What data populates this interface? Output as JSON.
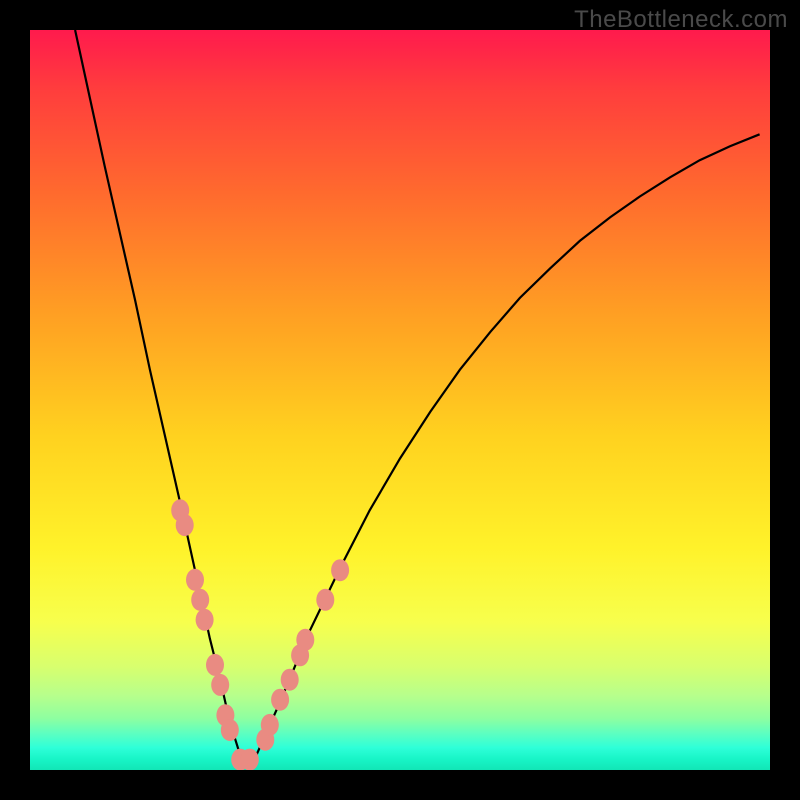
{
  "watermark": "TheBottleneck.com",
  "chart_data": {
    "type": "line",
    "title": "",
    "xlabel": "",
    "ylabel": "",
    "xlim": [
      0,
      100
    ],
    "ylim": [
      0,
      100
    ],
    "note": "V-shaped bottleneck curve; y is bottleneck percentage (0 at bottom = no bottleneck, 100 at top). Values estimated from pixel positions — no axes/ticks rendered in image.",
    "series": [
      {
        "name": "curve",
        "x": [
          6.1,
          8.1,
          10.1,
          12.2,
          14.2,
          16.2,
          18.2,
          20.3,
          22.3,
          24.3,
          25.7,
          27.0,
          28.4,
          30.4,
          33.8,
          37.8,
          41.9,
          45.9,
          50.0,
          54.1,
          58.1,
          62.2,
          66.2,
          70.3,
          74.3,
          78.4,
          82.4,
          86.5,
          90.5,
          94.6,
          98.6
        ],
        "y": [
          100.0,
          90.8,
          81.6,
          72.3,
          63.5,
          54.1,
          45.3,
          36.1,
          27.0,
          17.8,
          12.2,
          6.5,
          2.0,
          1.6,
          9.2,
          18.8,
          27.3,
          35.1,
          42.1,
          48.4,
          54.1,
          59.2,
          63.8,
          67.8,
          71.5,
          74.7,
          77.5,
          80.1,
          82.4,
          84.3,
          85.9
        ]
      }
    ],
    "markers": {
      "name": "highlighted-points",
      "color": "#e98b82",
      "points": [
        {
          "x": 20.3,
          "y": 35.1
        },
        {
          "x": 20.9,
          "y": 33.1
        },
        {
          "x": 22.3,
          "y": 25.7
        },
        {
          "x": 23.0,
          "y": 23.0
        },
        {
          "x": 23.6,
          "y": 20.3
        },
        {
          "x": 25.0,
          "y": 14.2
        },
        {
          "x": 25.7,
          "y": 11.5
        },
        {
          "x": 26.4,
          "y": 7.4
        },
        {
          "x": 27.0,
          "y": 5.4
        },
        {
          "x": 28.4,
          "y": 1.4
        },
        {
          "x": 29.7,
          "y": 1.4
        },
        {
          "x": 31.8,
          "y": 4.1
        },
        {
          "x": 32.4,
          "y": 6.1
        },
        {
          "x": 33.8,
          "y": 9.5
        },
        {
          "x": 35.1,
          "y": 12.2
        },
        {
          "x": 36.5,
          "y": 15.5
        },
        {
          "x": 37.2,
          "y": 17.6
        },
        {
          "x": 39.9,
          "y": 23.0
        },
        {
          "x": 41.9,
          "y": 27.0
        }
      ]
    }
  }
}
